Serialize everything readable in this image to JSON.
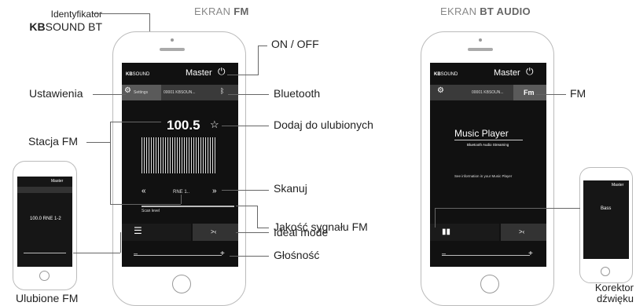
{
  "headings": {
    "fm_prefix": "EKRAN ",
    "fm_bold": "FM",
    "bt_prefix": "EKRAN ",
    "bt_bold": "BT AUDIO"
  },
  "annotations": {
    "identyfikator_line1": "Identyfikator",
    "identyfikator_kb": "KB",
    "identyfikator_rest": "SOUND BT",
    "on_off": "ON / OFF",
    "ustawienia": "Ustawienia",
    "bluetooth": "Bluetooth",
    "stacja_fm": "Stacja FM",
    "dodaj": "Dodaj do ulubionych",
    "skanuj": "Skanuj",
    "jakosc": "Jakość sygnału FM",
    "ideal": "Ideal mode",
    "glosnosc": "Głośność",
    "ulubione": "Ulubione FM",
    "fm_label": "FM",
    "korektor_line1": "Korektor",
    "korektor_line2": "dźwięku"
  },
  "fm_screen": {
    "logo_kb": "KB",
    "logo_rest": "SOUND",
    "master": "Master",
    "settings": "Settings",
    "device_id": "00001 KBSOUN...",
    "frequency": "100.5",
    "station_name": "RNE 1..",
    "scan_level": "Scan level",
    "prev": "«",
    "next": "»",
    "star": "☆",
    "ideal_icon": ">‹",
    "plus": "+",
    "minus": "—"
  },
  "bt_screen": {
    "logo_kb": "KB",
    "logo_rest": "SOUND",
    "master": "Master",
    "device_id": "00001 KBSOUN...",
    "fm_button": "Fm",
    "music_player": "Music Player",
    "streaming": "Bluetooth Audio Streaming",
    "info": "See information in your Music Player",
    "ideal_icon": ">‹",
    "plus": "+"
  },
  "small_left": {
    "master": "Master",
    "station": "100.0 RNE 1-2"
  },
  "small_right": {
    "master": "Master",
    "bass": "Bass"
  }
}
